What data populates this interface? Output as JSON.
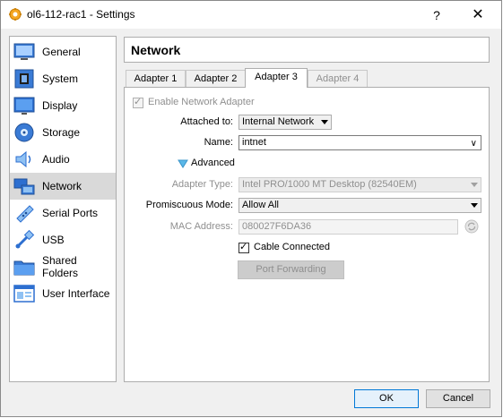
{
  "window": {
    "title": "ol6-112-rac1 - Settings",
    "help_glyph": "?",
    "close_glyph": "✕"
  },
  "sidebar": {
    "items": [
      {
        "label": "General",
        "icon": "general-icon"
      },
      {
        "label": "System",
        "icon": "system-icon"
      },
      {
        "label": "Display",
        "icon": "display-icon"
      },
      {
        "label": "Storage",
        "icon": "storage-icon"
      },
      {
        "label": "Audio",
        "icon": "audio-icon"
      },
      {
        "label": "Network",
        "icon": "network-icon",
        "selected": true
      },
      {
        "label": "Serial Ports",
        "icon": "serial-ports-icon"
      },
      {
        "label": "USB",
        "icon": "usb-icon"
      },
      {
        "label": "Shared Folders",
        "icon": "shared-folders-icon"
      },
      {
        "label": "User Interface",
        "icon": "user-interface-icon"
      }
    ]
  },
  "section": {
    "title": "Network"
  },
  "tabs": [
    {
      "label": "Adapter 1"
    },
    {
      "label": "Adapter 2"
    },
    {
      "label": "Adapter 3",
      "active": true
    },
    {
      "label": "Adapter 4",
      "disabled": true
    }
  ],
  "adapter": {
    "enable_label": "Enable Network Adapter",
    "enable_checked": true,
    "attached_to_label": "Attached to:",
    "attached_to_value": "Internal Network",
    "name_label": "Name:",
    "name_value": "intnet",
    "advanced_label": "Advanced",
    "adapter_type_label": "Adapter Type:",
    "adapter_type_value": "Intel PRO/1000 MT Desktop (82540EM)",
    "promiscuous_label": "Promiscuous Mode:",
    "promiscuous_value": "Allow All",
    "mac_label": "MAC Address:",
    "mac_value": "080027F6DA36",
    "cable_label": "Cable Connected",
    "cable_checked": true,
    "port_forwarding_label": "Port Forwarding"
  },
  "footer": {
    "ok_label": "OK",
    "cancel_label": "Cancel"
  },
  "colors": {
    "accent": "#0078d7",
    "selected_bg": "#d9d9d9",
    "disabled_text": "#8f8f8f"
  }
}
